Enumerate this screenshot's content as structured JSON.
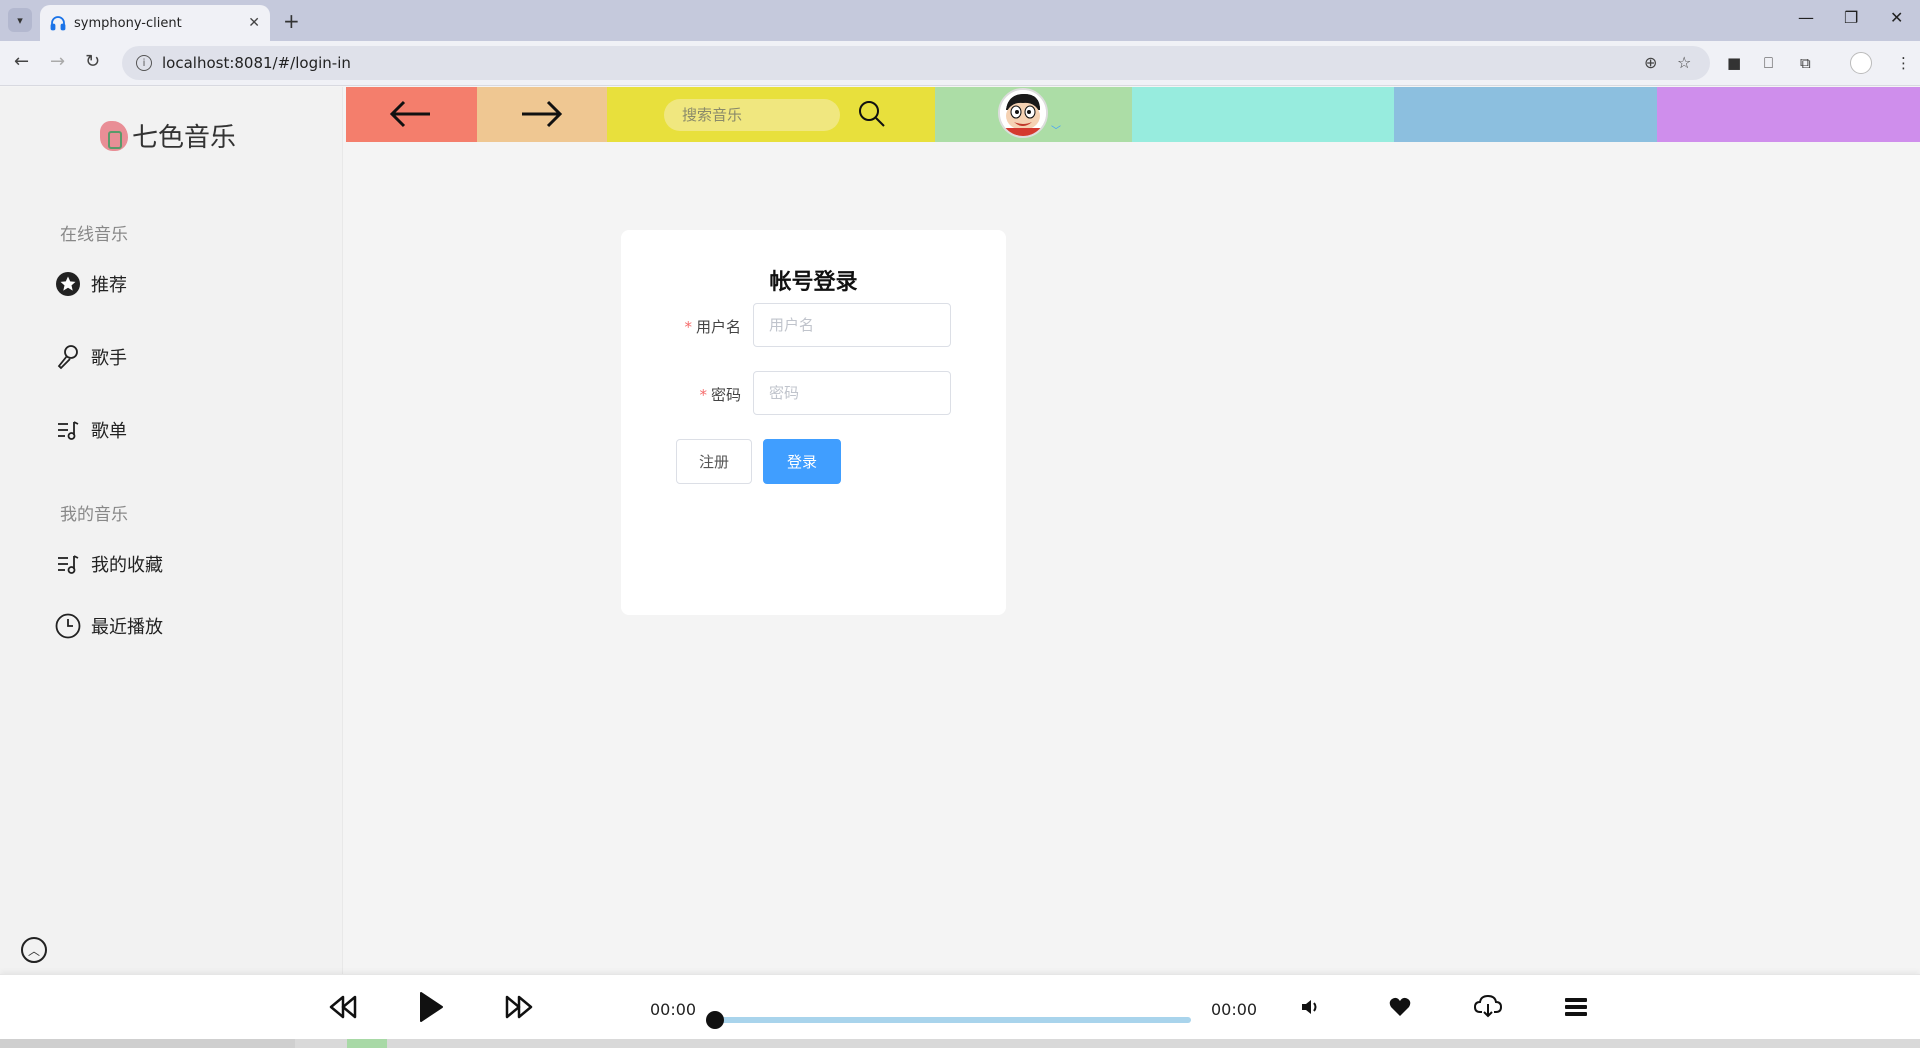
{
  "browser": {
    "tab_title": "symphony-client",
    "url": "localhost:8081/#/login-in",
    "new_tab_symbol": "+",
    "close_symbol": "✕",
    "minimize_symbol": "—",
    "restore_symbol": "❐"
  },
  "app": {
    "logo_text": "七色音乐"
  },
  "sidebar": {
    "section_online": "在线音乐",
    "section_mine": "我的音乐",
    "items": [
      {
        "label": "推荐",
        "icon": "star-circle-icon"
      },
      {
        "label": "歌手",
        "icon": "microphone-icon"
      },
      {
        "label": "歌单",
        "icon": "playlist-icon"
      },
      {
        "label": "我的收藏",
        "icon": "playlist-icon"
      },
      {
        "label": "最近播放",
        "icon": "clock-icon"
      }
    ]
  },
  "header": {
    "search_placeholder": "搜索音乐",
    "colors": [
      "#f47e6c",
      "#efc792",
      "#e8e03c",
      "#acdda6",
      "#97ecde",
      "#8cbfdf",
      "#cf8eec"
    ]
  },
  "login": {
    "title": "帐号登录",
    "username_label": "用户名",
    "username_placeholder": "用户名",
    "password_label": "密码",
    "password_placeholder": "密码",
    "required_mark": "*",
    "register_button": "注册",
    "login_button": "登录"
  },
  "player": {
    "current_time": "00:00",
    "total_time": "00:00",
    "progress": 0
  },
  "colors": {
    "accent": "#409eff",
    "required": "#f56c6c",
    "progress_track": "#a9d4ec"
  }
}
